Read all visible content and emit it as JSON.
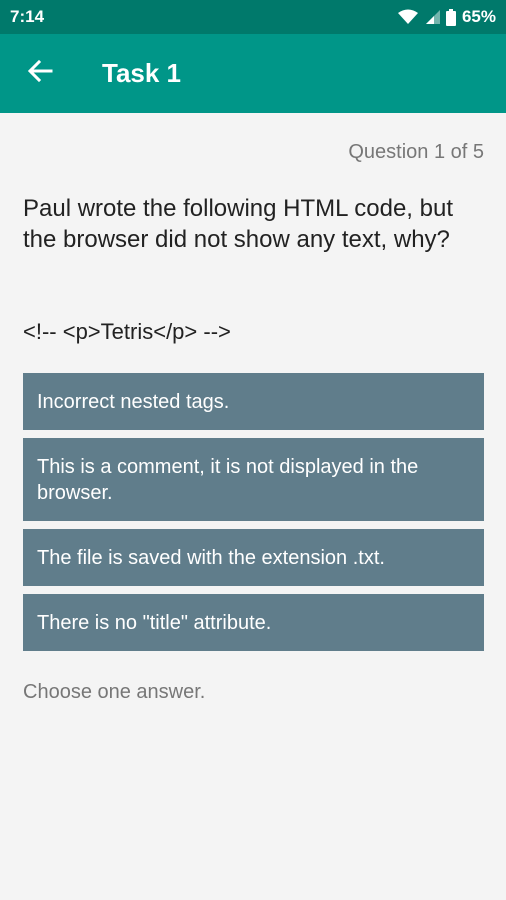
{
  "status_bar": {
    "time": "7:14",
    "battery": "65%"
  },
  "app_bar": {
    "title": "Task 1",
    "back_icon": "arrow-left-icon"
  },
  "quiz": {
    "progress": "Question 1 of 5",
    "question": "Paul wrote the following HTML code, but the browser did not show any text, why?",
    "code": "<!-- <p>Tetris</p> -->",
    "answers": [
      "Incorrect nested tags.",
      "This is a comment, it is not displayed in the browser.",
      "The file is saved with the extension .txt.",
      "There is no \"title\" attribute."
    ],
    "hint": "Choose one answer."
  },
  "colors": {
    "status_bar": "#00796b",
    "app_bar": "#009688",
    "answer_bg": "#607d8b",
    "background": "#f4f4f4"
  }
}
